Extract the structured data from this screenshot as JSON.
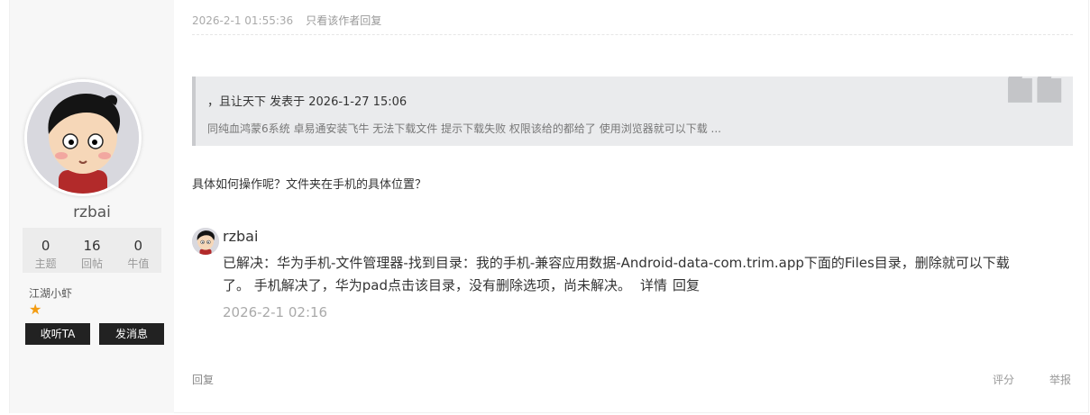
{
  "post_meta": {
    "timestamp": "2026-2-1 01:55:36",
    "only_author_reply": "只看该作者回复"
  },
  "author": {
    "username": "rzbai",
    "stats": [
      {
        "value": "0",
        "label": "主题"
      },
      {
        "value": "16",
        "label": "回帖"
      },
      {
        "value": "0",
        "label": "牛值"
      }
    ],
    "rank": "江湖小虾",
    "star": "★",
    "follow_label": "收听TA",
    "message_label": "发消息"
  },
  "quote": {
    "header": "，且让天下 发表于 2026-1-27 15:06",
    "body": "同纯血鸿蒙6系统 卓易通安装飞牛 无法下载文件 提示下载失败 权限该给的都给了  使用浏览器就可以下载 ..."
  },
  "question": "具体如何操作呢？文件夹在手机的具体位置？",
  "comment": {
    "username": "rzbai",
    "text": "已解决：华为手机-文件管理器-找到目录：我的手机-兼容应用数据-Android-data-com.trim.app下面的Files目录，删除就可以下载了。 手机解决了，华为pad点击该目录，没有删除选项，尚未解决。",
    "details_label": "详情",
    "reply_label": "回复",
    "time": "2026-2-1 02:16"
  },
  "footer": {
    "reply_label": "回复",
    "rate_label": "评分",
    "report_label": "举报"
  }
}
